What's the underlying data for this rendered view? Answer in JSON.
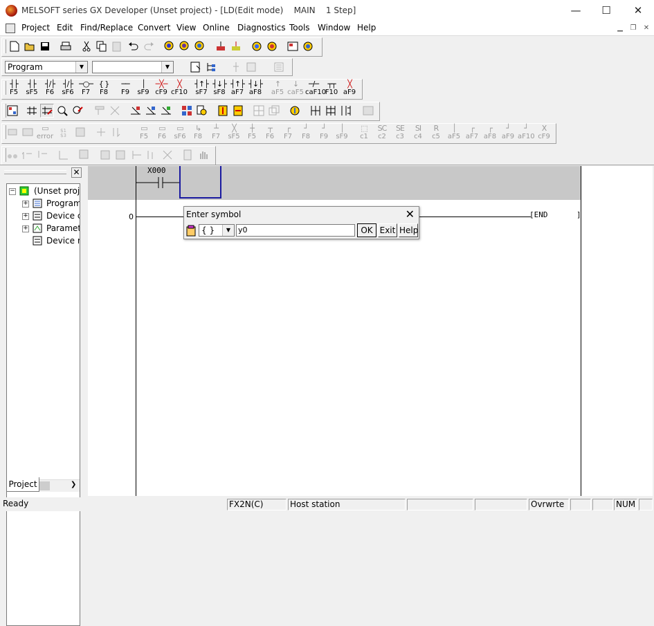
{
  "window": {
    "title": "MELSOFT series GX Developer (Unset project) - [LD(Edit mode)    MAIN    1 Step]",
    "minimize": "—",
    "maximize": "☐",
    "close": "✕"
  },
  "menu": {
    "items": [
      "Project",
      "Edit",
      "Find/Replace",
      "Convert",
      "View",
      "Online",
      "Diagnostics",
      "Tools",
      "Window",
      "Help"
    ]
  },
  "toolbar": {
    "program_combo": "Program",
    "device_combo": "",
    "fkeys": [
      {
        "sym": "┤├",
        "label": "F5"
      },
      {
        "sym": "┤├",
        "label": "sF5"
      },
      {
        "sym": "┤/├",
        "label": "F6"
      },
      {
        "sym": "┤/├",
        "label": "sF6"
      },
      {
        "sym": "─○─",
        "label": "F7"
      },
      {
        "sym": "{ }",
        "label": "F8"
      },
      {
        "sym": "──",
        "label": "F9"
      },
      {
        "sym": "│",
        "label": "sF9"
      },
      {
        "sym": "─╳─",
        "label": "cF9"
      },
      {
        "sym": "╳",
        "label": "cF10"
      },
      {
        "sym": "┤↑├",
        "label": "sF7"
      },
      {
        "sym": "┤↓├",
        "label": "sF8"
      },
      {
        "sym": "┤↑├",
        "label": "aF7"
      },
      {
        "sym": "┤↓├",
        "label": "aF8"
      },
      {
        "sym": "↑",
        "label": "aF5"
      },
      {
        "sym": "↓",
        "label": "caF5"
      },
      {
        "sym": "─/─",
        "label": "caF10"
      },
      {
        "sym": "┬┬",
        "label": "F10"
      },
      {
        "sym": "╳",
        "label": "aF9"
      }
    ],
    "fkeys2": [
      "F5",
      "F6",
      "sF6",
      "F8",
      "F7",
      "sF5",
      "F5",
      "F6",
      "F7",
      "F8",
      "F9",
      "sF9",
      "c1",
      "c2",
      "c3",
      "c4",
      "c5",
      "aF5",
      "aF7",
      "aF8",
      "aF9",
      "aF10",
      "cF9"
    ]
  },
  "project_tree": {
    "root": "(Unset project)",
    "items": [
      "Program",
      "Device comment",
      "Parameter",
      "Device memory"
    ],
    "tab": "Project"
  },
  "ladder": {
    "contact_label": "X000",
    "step": "0",
    "end_label": "END"
  },
  "dialog": {
    "title": "Enter symbol",
    "combo_value": "{ }",
    "input_value": "y0",
    "ok": "OK",
    "exit": "Exit",
    "help": "Help"
  },
  "status": {
    "ready": "Ready",
    "plc": "FX2N(C)",
    "station": "Host station",
    "mode": "Ovrwrte",
    "num": "NUM"
  }
}
